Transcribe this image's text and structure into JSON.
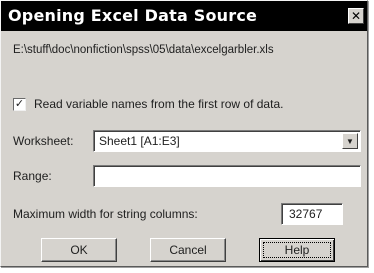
{
  "dialog": {
    "title": "Opening Excel Data Source",
    "close_symbol": "✕",
    "file_path": "E:\\stuff\\doc\\nonfiction\\spss\\05\\data\\excelgarbler.xls",
    "read_names": {
      "checked": true,
      "mark": "✓",
      "label": "Read variable names from the first row of data."
    },
    "worksheet": {
      "label": "Worksheet:",
      "value": "Sheet1  [A1:E3]",
      "arrow": "▼"
    },
    "range": {
      "label": "Range:",
      "value": ""
    },
    "max_width": {
      "label": "Maximum width for string columns:",
      "value": "32767"
    },
    "buttons": {
      "ok": "OK",
      "cancel": "Cancel",
      "help": "Help"
    }
  }
}
